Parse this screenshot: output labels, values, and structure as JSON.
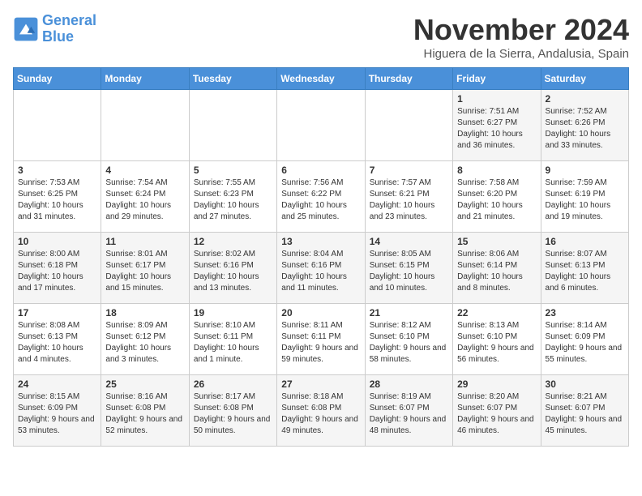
{
  "logo": {
    "line1": "General",
    "line2": "Blue"
  },
  "title": "November 2024",
  "subtitle": "Higuera de la Sierra, Andalusia, Spain",
  "weekdays": [
    "Sunday",
    "Monday",
    "Tuesday",
    "Wednesday",
    "Thursday",
    "Friday",
    "Saturday"
  ],
  "weeks": [
    [
      {
        "day": "",
        "info": ""
      },
      {
        "day": "",
        "info": ""
      },
      {
        "day": "",
        "info": ""
      },
      {
        "day": "",
        "info": ""
      },
      {
        "day": "",
        "info": ""
      },
      {
        "day": "1",
        "info": "Sunrise: 7:51 AM\nSunset: 6:27 PM\nDaylight: 10 hours and 36 minutes."
      },
      {
        "day": "2",
        "info": "Sunrise: 7:52 AM\nSunset: 6:26 PM\nDaylight: 10 hours and 33 minutes."
      }
    ],
    [
      {
        "day": "3",
        "info": "Sunrise: 7:53 AM\nSunset: 6:25 PM\nDaylight: 10 hours and 31 minutes."
      },
      {
        "day": "4",
        "info": "Sunrise: 7:54 AM\nSunset: 6:24 PM\nDaylight: 10 hours and 29 minutes."
      },
      {
        "day": "5",
        "info": "Sunrise: 7:55 AM\nSunset: 6:23 PM\nDaylight: 10 hours and 27 minutes."
      },
      {
        "day": "6",
        "info": "Sunrise: 7:56 AM\nSunset: 6:22 PM\nDaylight: 10 hours and 25 minutes."
      },
      {
        "day": "7",
        "info": "Sunrise: 7:57 AM\nSunset: 6:21 PM\nDaylight: 10 hours and 23 minutes."
      },
      {
        "day": "8",
        "info": "Sunrise: 7:58 AM\nSunset: 6:20 PM\nDaylight: 10 hours and 21 minutes."
      },
      {
        "day": "9",
        "info": "Sunrise: 7:59 AM\nSunset: 6:19 PM\nDaylight: 10 hours and 19 minutes."
      }
    ],
    [
      {
        "day": "10",
        "info": "Sunrise: 8:00 AM\nSunset: 6:18 PM\nDaylight: 10 hours and 17 minutes."
      },
      {
        "day": "11",
        "info": "Sunrise: 8:01 AM\nSunset: 6:17 PM\nDaylight: 10 hours and 15 minutes."
      },
      {
        "day": "12",
        "info": "Sunrise: 8:02 AM\nSunset: 6:16 PM\nDaylight: 10 hours and 13 minutes."
      },
      {
        "day": "13",
        "info": "Sunrise: 8:04 AM\nSunset: 6:16 PM\nDaylight: 10 hours and 11 minutes."
      },
      {
        "day": "14",
        "info": "Sunrise: 8:05 AM\nSunset: 6:15 PM\nDaylight: 10 hours and 10 minutes."
      },
      {
        "day": "15",
        "info": "Sunrise: 8:06 AM\nSunset: 6:14 PM\nDaylight: 10 hours and 8 minutes."
      },
      {
        "day": "16",
        "info": "Sunrise: 8:07 AM\nSunset: 6:13 PM\nDaylight: 10 hours and 6 minutes."
      }
    ],
    [
      {
        "day": "17",
        "info": "Sunrise: 8:08 AM\nSunset: 6:13 PM\nDaylight: 10 hours and 4 minutes."
      },
      {
        "day": "18",
        "info": "Sunrise: 8:09 AM\nSunset: 6:12 PM\nDaylight: 10 hours and 3 minutes."
      },
      {
        "day": "19",
        "info": "Sunrise: 8:10 AM\nSunset: 6:11 PM\nDaylight: 10 hours and 1 minute."
      },
      {
        "day": "20",
        "info": "Sunrise: 8:11 AM\nSunset: 6:11 PM\nDaylight: 9 hours and 59 minutes."
      },
      {
        "day": "21",
        "info": "Sunrise: 8:12 AM\nSunset: 6:10 PM\nDaylight: 9 hours and 58 minutes."
      },
      {
        "day": "22",
        "info": "Sunrise: 8:13 AM\nSunset: 6:10 PM\nDaylight: 9 hours and 56 minutes."
      },
      {
        "day": "23",
        "info": "Sunrise: 8:14 AM\nSunset: 6:09 PM\nDaylight: 9 hours and 55 minutes."
      }
    ],
    [
      {
        "day": "24",
        "info": "Sunrise: 8:15 AM\nSunset: 6:09 PM\nDaylight: 9 hours and 53 minutes."
      },
      {
        "day": "25",
        "info": "Sunrise: 8:16 AM\nSunset: 6:08 PM\nDaylight: 9 hours and 52 minutes."
      },
      {
        "day": "26",
        "info": "Sunrise: 8:17 AM\nSunset: 6:08 PM\nDaylight: 9 hours and 50 minutes."
      },
      {
        "day": "27",
        "info": "Sunrise: 8:18 AM\nSunset: 6:08 PM\nDaylight: 9 hours and 49 minutes."
      },
      {
        "day": "28",
        "info": "Sunrise: 8:19 AM\nSunset: 6:07 PM\nDaylight: 9 hours and 48 minutes."
      },
      {
        "day": "29",
        "info": "Sunrise: 8:20 AM\nSunset: 6:07 PM\nDaylight: 9 hours and 46 minutes."
      },
      {
        "day": "30",
        "info": "Sunrise: 8:21 AM\nSunset: 6:07 PM\nDaylight: 9 hours and 45 minutes."
      }
    ]
  ]
}
